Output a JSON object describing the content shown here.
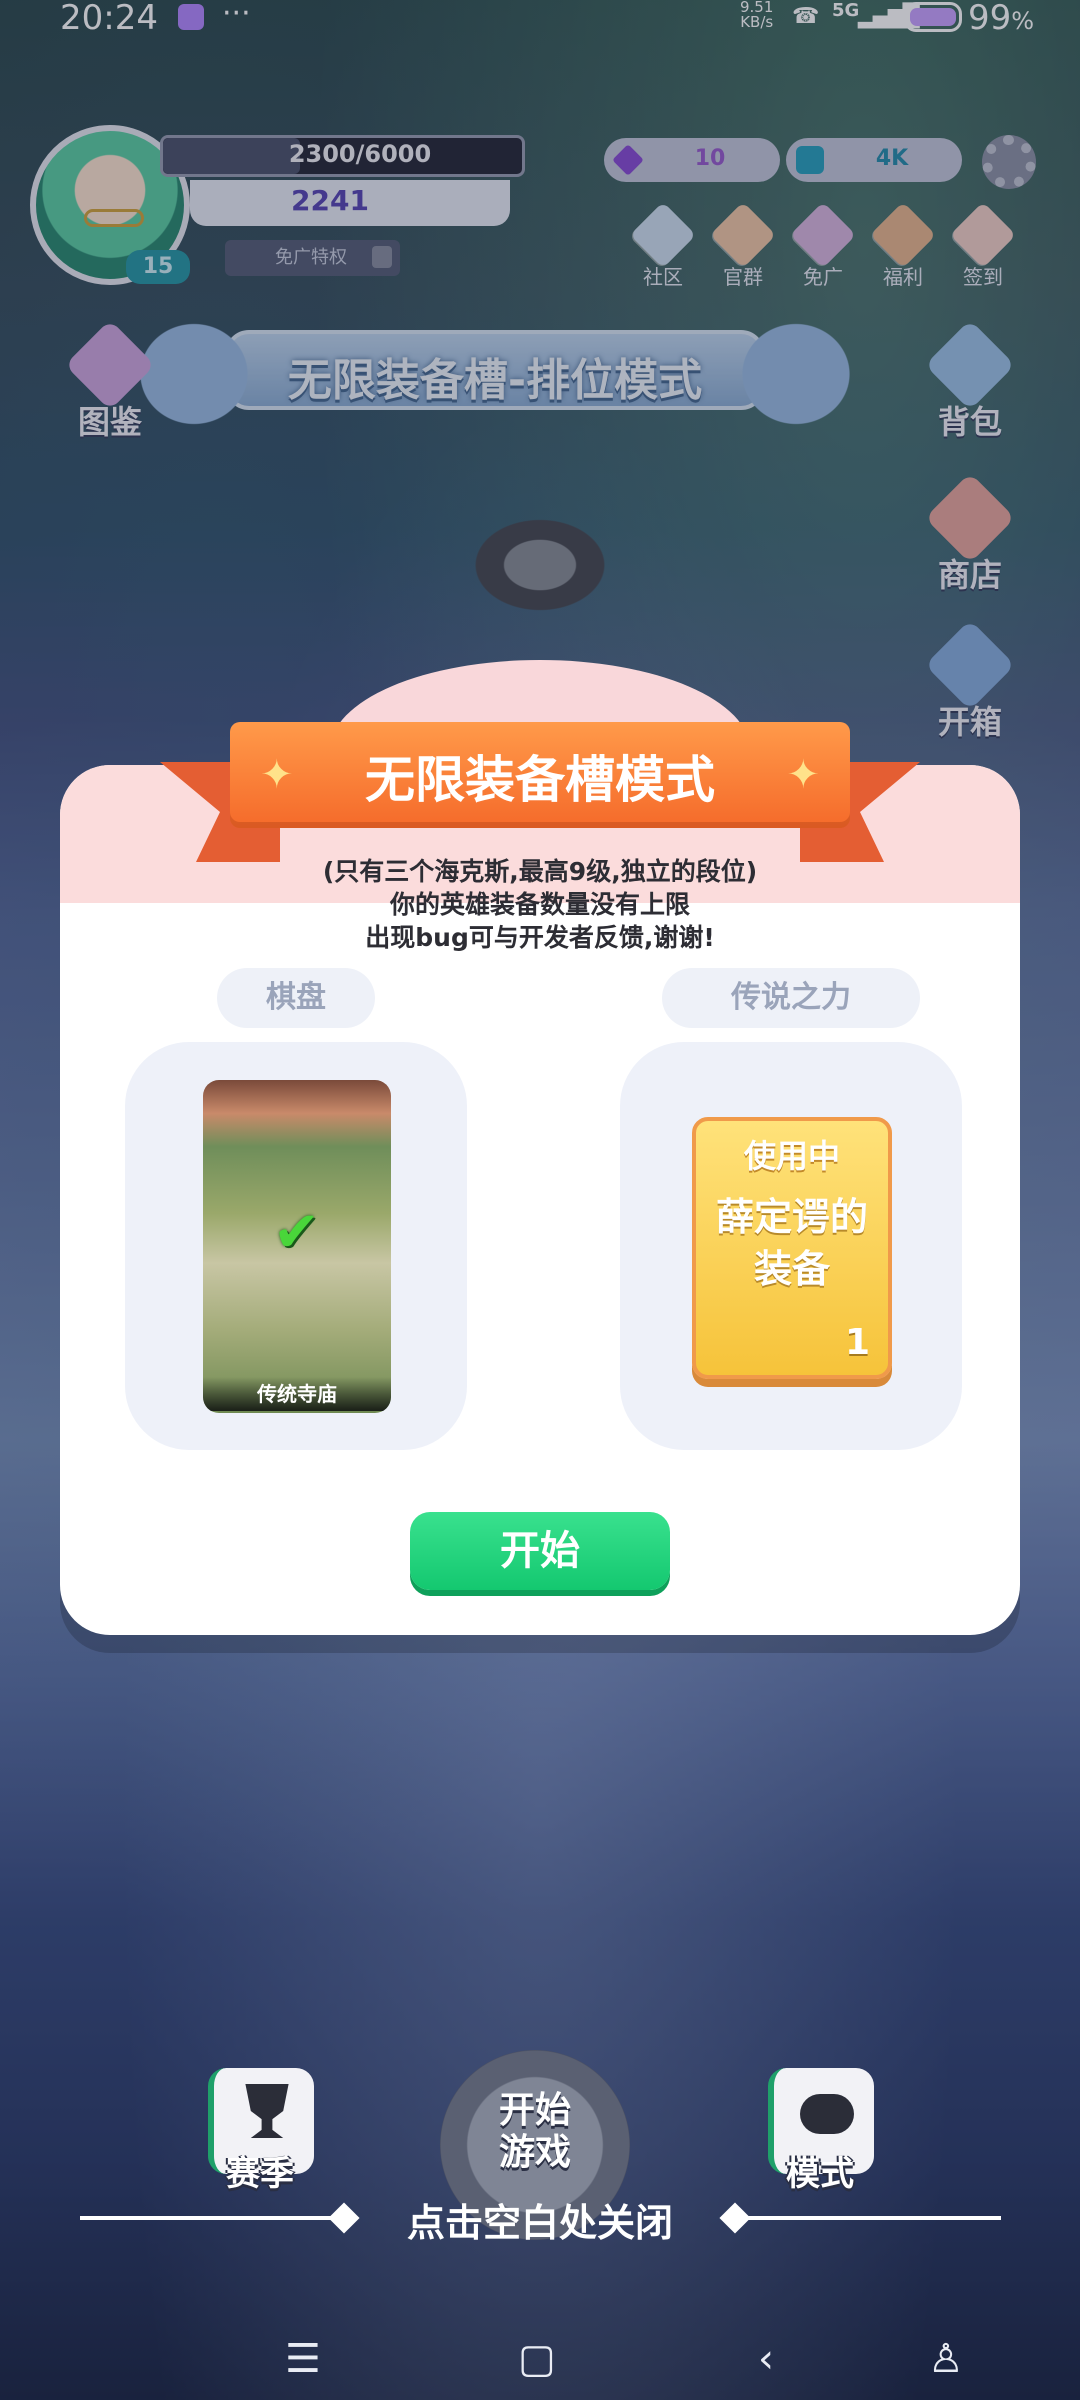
{
  "status_bar": {
    "time": "20:24",
    "speed_value": "9.51",
    "speed_unit": "KB/s",
    "network": "5G",
    "battery": "99",
    "battery_unit": "%"
  },
  "player": {
    "level": "15",
    "exp_text": "2300/6000",
    "exp_progress": 0.383,
    "score": "2241",
    "no_ad_label": "免广特权"
  },
  "currency": {
    "gems": "10",
    "cubes": "4K"
  },
  "top_icons": [
    {
      "label": "社区",
      "icon": "paper-plane-icon"
    },
    {
      "label": "官群",
      "icon": "group-icon"
    },
    {
      "label": "免广",
      "icon": "clapper-icon"
    },
    {
      "label": "福利",
      "icon": "treasure-chest-icon"
    },
    {
      "label": "签到",
      "icon": "calendar-icon"
    }
  ],
  "mode_banner": "无限装备槽-排位模式",
  "side_left": [
    {
      "label": "图鉴",
      "icon": "book-icon"
    }
  ],
  "side_right": [
    {
      "label": "背包",
      "icon": "backpack-icon"
    },
    {
      "label": "商店",
      "icon": "shop-icon"
    },
    {
      "label": "开箱",
      "icon": "chest-icon"
    }
  ],
  "modal": {
    "title": "无限装备槽模式",
    "desc_line1": "(只有三个海克斯,最高9级,独立的段位)",
    "desc_line2": "你的英雄装备数量没有上限",
    "desc_line3": "出现bug可与开发者反馈,谢谢!",
    "board_label": "棋盘",
    "legend_label": "传说之力",
    "board_name": "传统寺庙",
    "legend_status": "使用中",
    "legend_name": "薛定谔的装备",
    "legend_count": "1",
    "start_button": "开始"
  },
  "bottom": {
    "season_label": "赛季",
    "play_label_line1": "开始",
    "play_label_line2": "游戏",
    "mode_label": "模式",
    "close_hint": "点击空白处关闭"
  },
  "colors": {
    "ribbon": "#f56a2a",
    "start_button": "#14c870",
    "legend_card": "#f6c33a"
  }
}
